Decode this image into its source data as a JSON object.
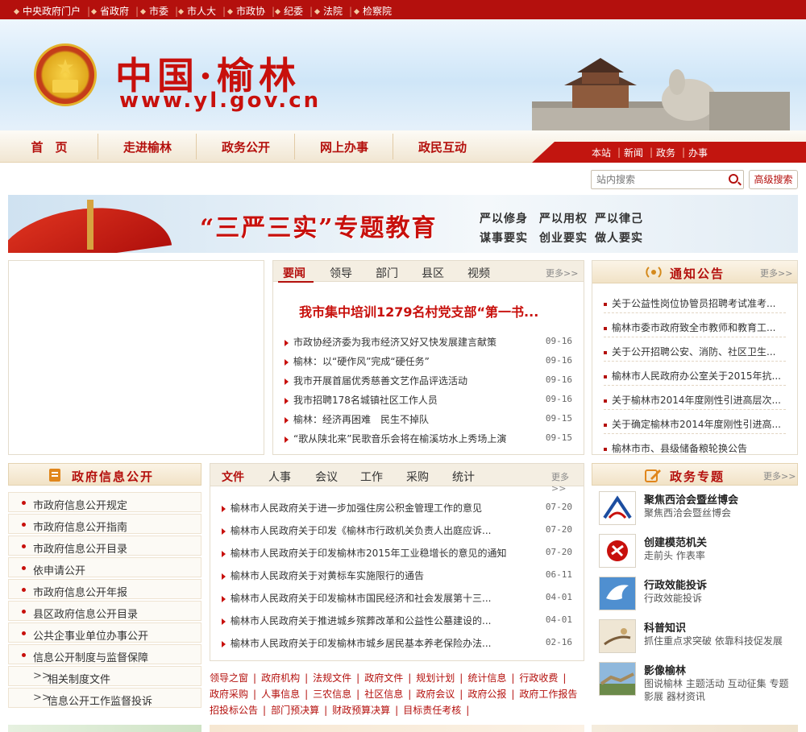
{
  "topbar": {
    "links": [
      "中央政府门户",
      "省政府",
      "市委",
      "市人大",
      "市政协",
      "纪委",
      "法院",
      "检察院"
    ]
  },
  "header": {
    "title_cn": "中国·榆林",
    "url": "www.yl.gov.cn"
  },
  "nav": {
    "items": [
      "首　页",
      "走进榆林",
      "政务公开",
      "网上办事",
      "政民互动"
    ],
    "right_links": [
      "本站",
      "新闻",
      "政务",
      "办事"
    ]
  },
  "search": {
    "placeholder": "站内搜索",
    "advanced_label": "高级搜索"
  },
  "banner": {
    "title": "“三严三实”专题教育",
    "slogans_row1": [
      "严以修身",
      "严以用权",
      "严以律己"
    ],
    "slogans_row2": [
      "谋事要实",
      "创业要实",
      "做人要实"
    ]
  },
  "news": {
    "tabs": [
      "要闻",
      "领导",
      "部门",
      "县区",
      "视频"
    ],
    "more": "更多>>",
    "headline": "我市集中培训1279名村党支部“第一书...",
    "items": [
      {
        "title": "市政协经济委为我市经济又好又快发展建言献策",
        "date": "09-16"
      },
      {
        "title": "榆林：以“硬作风”完成“硬任务”",
        "date": "09-16"
      },
      {
        "title": "我市开展首届优秀慈善文艺作品评选活动",
        "date": "09-16"
      },
      {
        "title": "我市招聘178名城镇社区工作人员",
        "date": "09-16"
      },
      {
        "title": "榆林：经济再困难　民生不掉队",
        "date": "09-15"
      },
      {
        "title": "“歌从陕北来”民歌音乐会将在榆溪坊水上秀场上演",
        "date": "09-15"
      }
    ]
  },
  "notice": {
    "title": "通知公告",
    "more": "更多>>",
    "items": [
      "关于公益性岗位协管员招聘考试准考...",
      "榆林市委市政府致全市教师和教育工...",
      "关于公开招聘公安、消防、社区卫生...",
      "榆林市人民政府办公室关于2015年抗...",
      "关于榆林市2014年度刚性引进高层次...",
      "关于确定榆林市2014年度刚性引进高...",
      "榆林市市、县级储备粮轮换公告"
    ]
  },
  "info_public": {
    "title": "政府信息公开",
    "items": [
      "市政府信息公开规定",
      "市政府信息公开指南",
      "市政府信息公开目录",
      "依申请公开",
      "市政府信息公开年报",
      "县区政府信息公开目录",
      "公共企事业单位办事公开",
      "信息公开制度与监督保障",
      "相关制度文件",
      "信息公开工作监督投诉"
    ]
  },
  "docs": {
    "tabs": [
      "文件",
      "人事",
      "会议",
      "工作",
      "采购",
      "统计"
    ],
    "more": "更多>>",
    "items": [
      {
        "title": "榆林市人民政府关于进一步加强住房公积金管理工作的意见",
        "date": "07-20"
      },
      {
        "title": "榆林市人民政府关于印发《榆林市行政机关负责人出庭应诉...",
        "date": "07-20"
      },
      {
        "title": "榆林市人民政府关于印发榆林市2015年工业稳增长的意见的通知",
        "date": "07-20"
      },
      {
        "title": "榆林市人民政府关于对黄标车实施限行的通告",
        "date": "06-11"
      },
      {
        "title": "榆林市人民政府关于印发榆林市国民经济和社会发展第十三...",
        "date": "04-01"
      },
      {
        "title": "榆林市人民政府关于推进城乡殡葬改革和公益性公墓建设的...",
        "date": "04-01"
      },
      {
        "title": "榆林市人民政府关于印发榆林市城乡居民基本养老保险办法...",
        "date": "02-16"
      }
    ]
  },
  "links": [
    "领导之窗",
    "政府机构",
    "法规文件",
    "政府文件",
    "规划计划",
    "统计信息",
    "行政收费",
    "政府采购",
    "人事信息",
    "三农信息",
    "社区信息",
    "政府会议",
    "政府公报",
    "政府工作报告",
    "招投标公告",
    "部门预决算",
    "财政预算决算",
    "目标责任考核"
  ],
  "topics": {
    "title": "政务专题",
    "more": "更多>>",
    "items": [
      {
        "title": "聚焦西洽会暨丝博会",
        "sub": "聚焦西洽会暨丝博会"
      },
      {
        "title": "创建模范机关",
        "sub": "走前头 作表率"
      },
      {
        "title": "行政效能投诉",
        "sub": "行政效能投诉"
      },
      {
        "title": "科普知识",
        "sub": "抓住重点求突破 依靠科技促发展"
      },
      {
        "title": "影像榆林",
        "sub": "图说榆林 主题活动 互动征集 专题影展 器材资讯"
      }
    ]
  },
  "colors": {
    "brand_red": "#b4100d",
    "nav_bg": "#f1e6d2"
  }
}
